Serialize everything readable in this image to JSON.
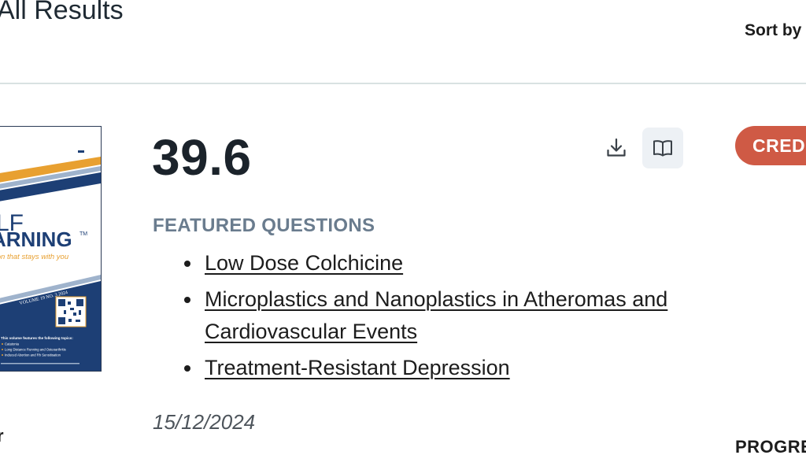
{
  "header": {
    "title": "All Results",
    "sort_label": "Sort by"
  },
  "result": {
    "cover": {
      "title_line1": "LF",
      "title_line2": "ARNING",
      "trademark": "TM",
      "tagline": "tion that stays with you",
      "volume": "VOLUME 19 NO. 3 2024",
      "topics_heading": "This volume features the following topics:",
      "topics": [
        "Catatonia",
        "Long Distance Running and Osteoarthritis",
        "Induced Abortion and Rh Sensitisation"
      ],
      "colors": {
        "navy": "#1d3f75",
        "gold": "#e8a030",
        "steel": "#9fb3cc"
      }
    },
    "score": "39.6",
    "actions": {
      "download_icon": "download-icon",
      "read_icon": "open-book-icon"
    },
    "featured_heading": "FEATURED QUESTIONS",
    "questions": [
      "Low Dose Colchicine",
      "Microplastics and Nanoplastics in Atheromas and Cardiovascular Events",
      "Treatment-Resistant Depression"
    ],
    "date": "15/12/2024",
    "credit_badge": "CREDI",
    "progress_label": "PROGRE",
    "left_stub": "r"
  },
  "colors": {
    "badge": "#cf5a45",
    "heading": "#6a7c8e",
    "read_button_bg": "#edf1f5"
  }
}
